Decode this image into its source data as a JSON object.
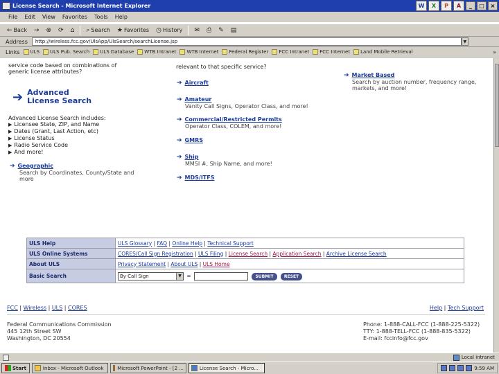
{
  "window": {
    "title": "License Search - Microsoft Internet Explorer"
  },
  "titlebar_apps": [
    "W",
    "X",
    "P",
    "A"
  ],
  "titlebar_controls": [
    "_",
    "□",
    "×"
  ],
  "menu": [
    "File",
    "Edit",
    "View",
    "Favorites",
    "Tools",
    "Help"
  ],
  "toolbar": {
    "back": "Back",
    "back_icon": "←",
    "forward_icon": "→",
    "stop_icon": "⊗",
    "refresh_icon": "⟳",
    "home_icon": "⌂",
    "search": "Search",
    "search_icon": "⌕",
    "favorites": "Favorites",
    "favorites_icon": "★",
    "history": "History",
    "history_icon": "◷",
    "mail_icon": "✉",
    "print_icon": "⎙",
    "edit_icon": "✎",
    "discuss_icon": "▤"
  },
  "address": {
    "label": "Address",
    "url": "http://wireless.fcc.gov/UlsApp/UlsSearch/searchLicense.jsp",
    "dropdown_icon": "▼"
  },
  "links": {
    "label": "Links",
    "items": [
      "ULS",
      "ULS Pub. Search",
      "ULS Database",
      "WTB Intranet",
      "WTB Internet",
      "Federal Register",
      "FCC Intranet",
      "FCC Internet",
      "Land Mobile Retrieval"
    ],
    "more": "»"
  },
  "left": {
    "intro_line1": "service code based on combinations of",
    "intro_line2": "generic license attributes?",
    "advanced_line1": "Advanced",
    "advanced_line2": "License Search",
    "includes_label": "Advanced License Search includes:",
    "bullets": [
      "Licensee State, ZIP, and Name",
      "Dates (Grant, Last Action, etc)",
      "License Status",
      "Radio Service Code",
      "And more!"
    ],
    "geo_title": "Geographic",
    "geo_desc1": "Search by Coordinates, County/State and",
    "geo_desc2": "more"
  },
  "middle": {
    "intro": "relevant to that specific service?",
    "services": [
      {
        "title": "Aircraft",
        "desc": ""
      },
      {
        "title": "Amateur",
        "desc": "Vanity Call Signs, Operator Class, and more!"
      },
      {
        "title": "Commercial/Restricted Permits",
        "desc": "Operator Class, COLEM, and more!"
      },
      {
        "title": "GMRS",
        "desc": ""
      },
      {
        "title": "Ship",
        "desc": "MMSI #, Ship Name, and more!"
      },
      {
        "title": "MDS/ITFS",
        "desc": ""
      }
    ]
  },
  "right": {
    "market_title": "Market Based",
    "market_desc1": "Search by auction number, frequency range,",
    "market_desc2": "markets, and more!"
  },
  "navtable": {
    "help_label": "ULS Help",
    "help_links": [
      "ULS Glossary",
      "FAQ",
      "Online Help",
      "Technical Support"
    ],
    "online_label": "ULS Online Systems",
    "online_links": [
      "CORES/Call Sign Registration",
      "ULS Filing",
      "License Search",
      "Application Search",
      "Archive License Search"
    ],
    "about_label": "About ULS",
    "about_links": [
      "Privacy Statement",
      "About ULS",
      "ULS Home"
    ],
    "basic_label": "Basic Search",
    "basic_select": "By Call Sign",
    "basic_equals": "=",
    "submit": "SUBMIT",
    "reset": "RESET"
  },
  "footer": {
    "links": [
      "FCC",
      "Wireless",
      "ULS",
      "CORES"
    ],
    "right_links": [
      "Help",
      "Tech Support"
    ],
    "addr_line1": "Federal Communications Commission",
    "addr_line2": "445 12th Street SW",
    "addr_line3": "Washington, DC 20554",
    "contact_line1": "Phone: 1-888-CALL-FCC (1-888-225-5322)",
    "contact_line2": "TTY: 1-888-TELL-FCC (1-888-835-5322)",
    "contact_line3": "E-mail: fccinfo@fcc.gov"
  },
  "status": {
    "zone": "Local intranet"
  },
  "taskbar": {
    "start": "Start",
    "tasks": [
      "Inbox - Microsoft Outlook",
      "Microsoft PowerPoint - [2 ...",
      "License Search - Micro..."
    ],
    "clock": "9:59 AM"
  },
  "colors": {
    "link": "#1a3a9c",
    "nav_header": "#c6cce2",
    "titlebar": "#1f3fae",
    "chrome": "#d4d0c8"
  }
}
